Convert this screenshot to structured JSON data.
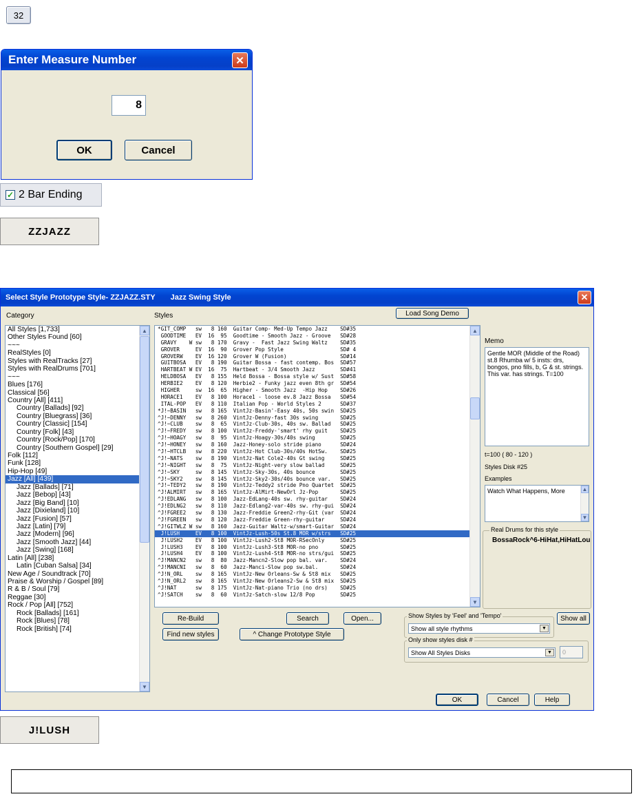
{
  "measure_button": {
    "label": "32"
  },
  "measure_dialog": {
    "title": "Enter Measure Number",
    "value": "8",
    "ok_label": "OK",
    "cancel_label": "Cancel"
  },
  "bar_ending": {
    "label": "2 Bar Ending",
    "checked": true
  },
  "style_button_1": {
    "label": "ZZJAZZ"
  },
  "style_dialog": {
    "title": "Select Style Prototype Style- ZZJAZZ.STY",
    "subtitle": "Jazz Swing Style",
    "category_label": "Category",
    "styles_label": "Styles",
    "load_song_demo": "Load Song Demo",
    "categories": [
      {
        "label": "All Styles [1,733]",
        "indent": false
      },
      {
        "label": "Other Styles Found [60]",
        "indent": false
      },
      {
        "label": "~~~",
        "indent": false
      },
      {
        "label": "RealStyles [0]",
        "indent": false
      },
      {
        "label": "Styles with RealTracks [27]",
        "indent": false
      },
      {
        "label": "Styles with RealDrums [701]",
        "indent": false
      },
      {
        "label": "~~~",
        "indent": false
      },
      {
        "label": "Blues [176]",
        "indent": false
      },
      {
        "label": "Classical [56]",
        "indent": false
      },
      {
        "label": "Country [All] [411]",
        "indent": false
      },
      {
        "label": "Country [Ballads] [92]",
        "indent": true
      },
      {
        "label": "Country [Bluegrass] [36]",
        "indent": true
      },
      {
        "label": "Country [Classic] [154]",
        "indent": true
      },
      {
        "label": "Country [Folk] [43]",
        "indent": true
      },
      {
        "label": "Country [Rock/Pop] [170]",
        "indent": true
      },
      {
        "label": "Country [Southern Gospel] [29]",
        "indent": true
      },
      {
        "label": "Folk [112]",
        "indent": false
      },
      {
        "label": "Funk [128]",
        "indent": false
      },
      {
        "label": "Hip-Hop [49]",
        "indent": false
      },
      {
        "label": "Jazz [All] [439]",
        "indent": false,
        "selected": true
      },
      {
        "label": "Jazz [Ballads] [71]",
        "indent": true
      },
      {
        "label": "Jazz [Bebop] [43]",
        "indent": true
      },
      {
        "label": "Jazz [Big Band] [10]",
        "indent": true
      },
      {
        "label": "Jazz [Dixieland] [10]",
        "indent": true
      },
      {
        "label": "Jazz [Fusion] [57]",
        "indent": true
      },
      {
        "label": "Jazz [Latin] [79]",
        "indent": true
      },
      {
        "label": "Jazz [Modern] [96]",
        "indent": true
      },
      {
        "label": "Jazz [Smooth Jazz] [44]",
        "indent": true
      },
      {
        "label": "Jazz [Swing] [168]",
        "indent": true
      },
      {
        "label": "Latin [All] [238]",
        "indent": false
      },
      {
        "label": "Latin [Cuban Salsa] [34]",
        "indent": true
      },
      {
        "label": "New Age / Soundtrack [70]",
        "indent": false
      },
      {
        "label": "Praise & Worship / Gospel [89]",
        "indent": false
      },
      {
        "label": "R & B / Soul [79]",
        "indent": false
      },
      {
        "label": "Reggae [30]",
        "indent": false
      },
      {
        "label": "Rock / Pop [All] [752]",
        "indent": false
      },
      {
        "label": "Rock [Ballads] [161]",
        "indent": true
      },
      {
        "label": "Rock [Blues] [78]",
        "indent": true
      },
      {
        "label": "Rock [British] [74]",
        "indent": true
      }
    ],
    "styles": [
      {
        "row": "*GIT_COMP   sw   8 160  Guitar Comp- Med-Up Tempo Jazz    SD#35"
      },
      {
        "row": " GOODTIME   EV  16  95  Goodtime - Smooth Jazz - Groove   SD#28"
      },
      {
        "row": " GRAVY    W sw   8 170  Gravy -  Fast Jazz Swing Waltz    SD#35"
      },
      {
        "row": " GROVER     EV  16  90  Grover Pop Style                  SD# 4"
      },
      {
        "row": " GROVERW    EV  16 120  Grover W (Fusion)                 SD#14"
      },
      {
        "row": " GUITBOSA   EV   8 190  Guitar Bossa - fast contemp. Bos  SD#57"
      },
      {
        "row": " HARTBEAT W EV  16  75  Hartbeat - 3/4 Smooth Jazz        SD#41"
      },
      {
        "row": " HELDBOSA   EV   8 155  Held Bossa - Bossa style w/ Sust  SD#58"
      },
      {
        "row": " HERBIE2    EV   8 120  Herbie2 - Funky jazz even 8th gr  SD#54"
      },
      {
        "row": " HIGHER     sw  16  65  Higher - Smooth Jazz  -Hip Hop    SD#26"
      },
      {
        "row": " HORACE1    EV   8 100  Horace1 - loose ev.8 Jazz Bossa   SD#54"
      },
      {
        "row": " ITAL-POP   EV   8 110  Italian Pop - World Styles 2      SD#37"
      },
      {
        "row": "*J!~BASIN   sw   8 165  VintJz-Basin'-Easy 40s, 50s swin  SD#25"
      },
      {
        "row": "^J!~DENNY   sw   8 260  VintJz-Denny-fast 30s swing       SD#25"
      },
      {
        "row": "^J!~CLUB    sw   8  65  VintJz-Club-30s, 40s sw. Ballad   SD#25"
      },
      {
        "row": "^J!~FREDY   sw   8 100  VintJz-Freddy-'smart' rhy guit    SD#25"
      },
      {
        "row": "^J!~HOAGY   sw   8  95  VintJz-Hoagy-30s/40s swing        SD#25"
      },
      {
        "row": "^J!~HONEY   sw   8 160  Jazz-Honey-solo stride piano      SD#24"
      },
      {
        "row": "^J!~HTCLB   sw   8 220  VintJz-Hot Club-30s/40s HotSw.    SD#25"
      },
      {
        "row": "^J!~NATS    sw   8 190  VintJz-Nat Cole2-40s Gt swing     SD#25"
      },
      {
        "row": "^J!~NIGHT   sw   8  75  VintJz-Night-very slow ballad     SD#25"
      },
      {
        "row": "^J!~SKY     sw   8 145  VintJz-Sky-30s, 40s bounce        SD#25"
      },
      {
        "row": "^J!~SKY2    sw   8 145  VintJz-Sky2-30s/40s bounce var.   SD#25"
      },
      {
        "row": "^J!~TEDY2   sw   8 190  VintJz-Teddy2 stride Pno Quartet  SD#25"
      },
      {
        "row": "^J!ALMIRT   sw   8 165  VintJz-AlMirt-NewOrl Jz-Pop       SD#25"
      },
      {
        "row": "^J!EDLANG   sw   8 100  Jazz-EdLang-40s sw. rhy-guitar    SD#24"
      },
      {
        "row": "^J!EDLNG2   sw   8 110  Jazz-Edlang2-var-40s sw. rhy-gui  SD#24"
      },
      {
        "row": "^J!FGREE2   sw   8 130  Jazz-Freddie Green2-rhy-Git (var  SD#24"
      },
      {
        "row": "^J!FGREEN   sw   8 120  Jazz-Freddie Green-rhy-guitar     SD#24"
      },
      {
        "row": "^J!GITWLZ W sw   8 160  Jazz-Guitar Waltz-w/smart-Guitar  SD#24"
      },
      {
        "row": " J!LUSH     EV   8 100  VintJz-Lush-50s St.8 MOR w/strs   SD#25",
        "selected": true
      },
      {
        "row": " J!LUSH2    EV   8 100  VintJz-Lush2-St8 MOR-RSecOnly     SD#25"
      },
      {
        "row": " J!LUSH3    EV   8 100  VintJz-Lush3-St8 MOR-no pno       SD#25"
      },
      {
        "row": " J!LUSH4    EV   8 100  VintJz-Lush4-St8 MOR-no strs/gui  SD#25"
      },
      {
        "row": "^J!MANCN2   sw   8  80  Jazz-Mancn2-Slow pop bal. var.    SD#24"
      },
      {
        "row": "^J!MANCNI   sw   8  60  Jazz-Manci-Slow pop sw.bal.       SD#24"
      },
      {
        "row": "^J!N_ORL    sw   8 165  VintJz-New Orleans-Sw & St8 mix   SD#25"
      },
      {
        "row": "^J!N_ORL2   sw   8 165  VintJz-New Orleans2-Sw & St8 mix  SD#25"
      },
      {
        "row": "^J!NAT      sw   8 175  VintJz-Nat-piano Trio (no drs)    SD#25"
      },
      {
        "row": "^J!SATCH    sw   8  60  VintJz-Satch-slow 12/8 Pop        SD#25"
      }
    ],
    "memo_label": "Memo",
    "memo_text": "Gentle MOR (Middle of the Road) st.8 Rhumba w/ 5 insts: drs, bongos, pno fills, b, G & st. strings. This var. has strings. T=100",
    "tempo_range": "t=100 ( 80 - 120 )",
    "styles_disk": "Styles Disk #25",
    "examples_label": "Examples",
    "examples_text": "Watch What Happens, More",
    "real_drums_label": "Real Drums for this style",
    "real_drums_value": "BossaRock^6-HiHat,HiHatLou",
    "rebuild_label": "Re-Build",
    "search_label": "Search",
    "open_label": "Open...",
    "find_new_label": "Find new styles",
    "change_proto_label": "^ Change Prototype Style",
    "feel_group_label": "Show Styles by 'Feel' and 'Tempo'",
    "feel_value": "Show all style rhythms",
    "show_all_label": "Show all",
    "disk_group_label": "Only show styles disk #",
    "disk_value": "Show All Styles Disks",
    "disk_number": "0",
    "ok_label": "OK",
    "cancel_label": "Cancel",
    "help_label": "Help"
  },
  "style_button_2": {
    "label": "J!LUSH"
  },
  "colors": {
    "title_blue": "#0a4bd8",
    "selection_blue": "#316ac5",
    "dialog_face": "#ece9d8"
  }
}
